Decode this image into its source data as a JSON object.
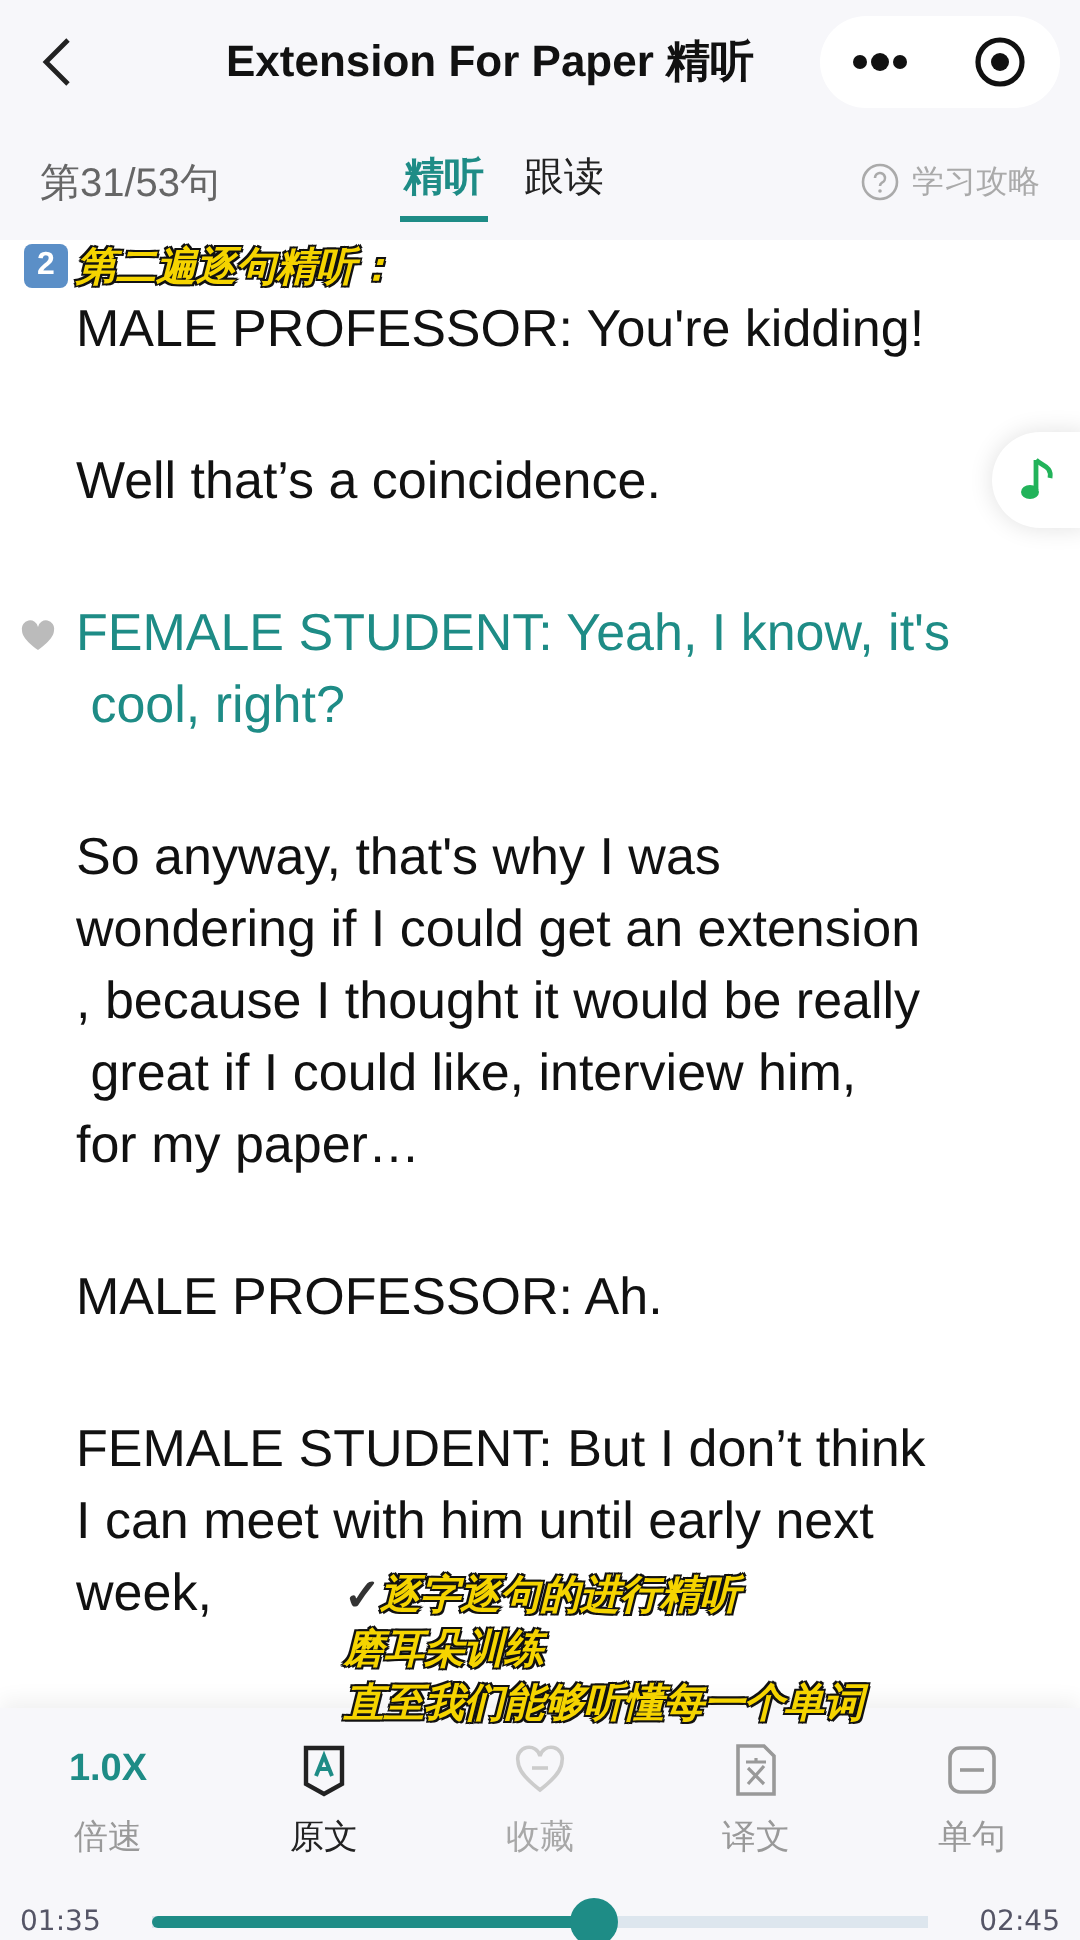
{
  "nav": {
    "title": "Extension For Paper 精听"
  },
  "sub": {
    "counter": "第31/53句",
    "tabs": [
      {
        "label": "精听",
        "selected": true
      },
      {
        "label": "跟读",
        "selected": false
      }
    ],
    "guide": "学习攻略"
  },
  "overlay_heading": {
    "badge": "2",
    "text": "第二遍逐句精听："
  },
  "paragraphs": [
    {
      "lines": [
        "MALE PROFESSOR: You're kidding!"
      ],
      "active": false
    },
    {
      "lines": [
        "Well that’s a coincidence."
      ],
      "active": false
    },
    {
      "lines": [
        "FEMALE STUDENT: Yeah, I know, it's",
        " cool, right?"
      ],
      "active": true
    },
    {
      "lines": [
        "So anyway, that's why I was",
        "wondering if I could get an extension",
        ", because I thought it would be really",
        " great if I could like, interview him,",
        "for my paper…"
      ],
      "active": false
    },
    {
      "lines": [
        "MALE PROFESSOR: Ah."
      ],
      "active": false
    },
    {
      "lines": [
        "FEMALE STUDENT: But I don’t think",
        "I can meet with him until early next",
        "week,"
      ],
      "active": false
    }
  ],
  "overlay_caption": {
    "mark": "✓",
    "lines": [
      "逐字逐句的进行精听",
      "磨耳朵训练",
      "直至我们能够听懂每一个单词"
    ]
  },
  "toolbar": [
    {
      "kind": "speed",
      "value": "1.0X",
      "label": "倍速",
      "selected": false,
      "disabled": false
    },
    {
      "kind": "text",
      "label": "原文",
      "selected": true,
      "disabled": false
    },
    {
      "kind": "favorite",
      "label": "收藏",
      "selected": false,
      "disabled": true
    },
    {
      "kind": "translate",
      "label": "译文",
      "selected": false,
      "disabled": false
    },
    {
      "kind": "single",
      "label": "单句",
      "selected": false,
      "disabled": false
    }
  ],
  "player": {
    "elapsed": "01:35",
    "total": "02:45",
    "level": 0.57
  }
}
